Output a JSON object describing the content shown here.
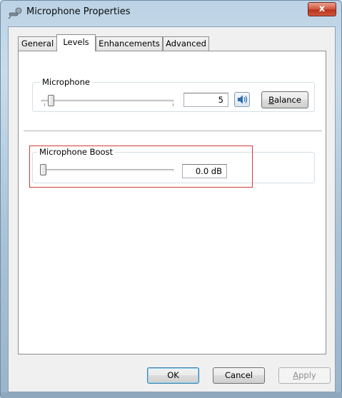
{
  "window": {
    "title": "Microphone Properties",
    "close_label": "x"
  },
  "tabs": [
    {
      "label": "General",
      "active": false
    },
    {
      "label": "Levels",
      "active": true
    },
    {
      "label": "Enhancements",
      "active": false
    },
    {
      "label": "Advanced",
      "active": false
    }
  ],
  "microphone": {
    "group_label": "Microphone",
    "value": "5",
    "level_percent": 5,
    "balance_label": "Balance"
  },
  "boost": {
    "group_label": "Microphone Boost",
    "value": "0.0 dB",
    "level_percent": 0
  },
  "footer": {
    "ok_label": "OK",
    "cancel_label": "Cancel",
    "apply_label": "Apply"
  },
  "colors": {
    "highlight": "#d23a3a",
    "accent": "#3c7fb1"
  },
  "icons": {
    "app": "microphone-icon",
    "mute": "speaker-icon",
    "close": "close-icon"
  }
}
